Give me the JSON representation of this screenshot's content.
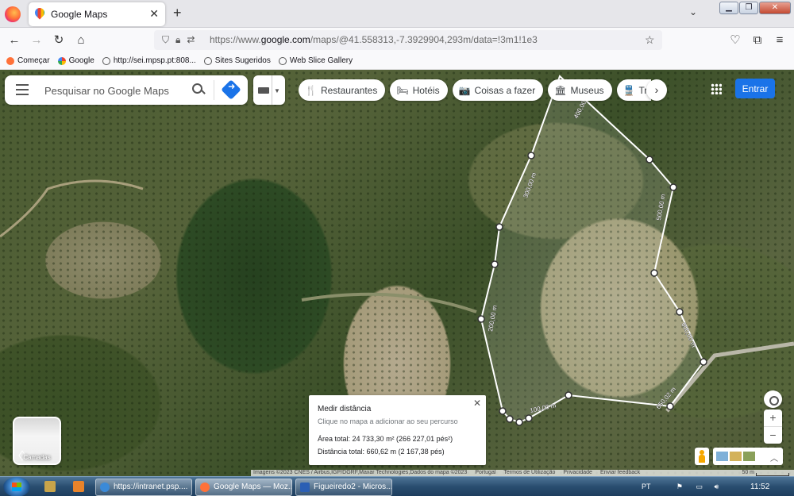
{
  "browser": {
    "tab_title": "Google Maps",
    "url_prefix": "https://www.",
    "url_domain": "google.com",
    "url_rest": "/maps/@41.558313,-7.3929904,293m/data=!3m1!1e3",
    "bookmarks": [
      {
        "label": "Começar",
        "icon": "firefox-icon"
      },
      {
        "label": "Google",
        "icon": "google-icon"
      },
      {
        "label": "http://sei.mpsp.pt:808...",
        "icon": "globe-icon"
      },
      {
        "label": "Sites Sugeridos",
        "icon": "globe-icon"
      },
      {
        "label": "Web Slice Gallery",
        "icon": "globe-icon"
      }
    ]
  },
  "maps": {
    "search_placeholder": "Pesquisar no Google Maps",
    "chips": [
      {
        "label": "Restaurantes",
        "icon": "🍴"
      },
      {
        "label": "Hotéis",
        "icon": "🛏"
      },
      {
        "label": "Coisas a fazer",
        "icon": "📷"
      },
      {
        "label": "Museus",
        "icon": "🏛"
      },
      {
        "label": "Transportes",
        "icon": "🚆"
      }
    ],
    "sign_in": "Entrar",
    "layers_label": "Camadas",
    "zoom_in": "+",
    "zoom_out": "−",
    "distance_labels": [
      "100,00 m",
      "200,00 m",
      "300,00 m",
      "400,00 m",
      "500,00 m",
      "600,00 m",
      "650,02 m"
    ],
    "measure": {
      "title": "Medir distância",
      "hint": "Clique no mapa a adicionar ao seu percurso",
      "area": "Área total: 24 733,30 m² (266 227,01 pés²)",
      "distance": "Distância total: 660,62 m (2 167,38 pés)"
    },
    "attribution": {
      "imagery": "Imagens ©2023 CNES / Airbus,IGP/DGRF,Maxar Technologies,Dados do mapa ©2023",
      "country": "Portugal",
      "terms": "Termos de Utilização",
      "privacy": "Privacidade",
      "feedback": "Enviar feedback",
      "scale": "50 m"
    }
  },
  "taskbar": {
    "tasks": [
      {
        "label": "https://intranet.psp....",
        "color": "#3b8ad8"
      },
      {
        "label": "Google Maps — Moz...",
        "color": "#ff7139"
      },
      {
        "label": "Figueiredo2 - Micros...",
        "color": "#2b5fb4"
      }
    ],
    "lang": "PT",
    "time": "11:52"
  }
}
